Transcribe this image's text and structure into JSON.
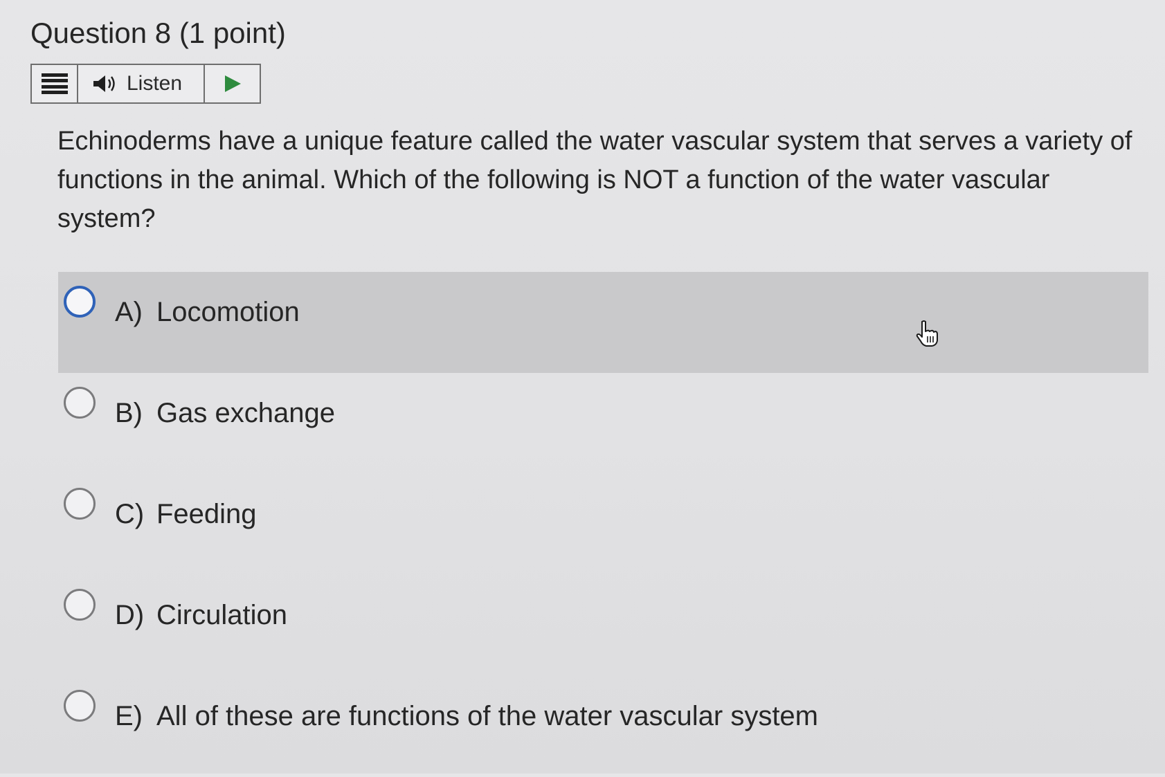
{
  "question": {
    "name": "Question 8",
    "points": "(1 point)"
  },
  "listen_toolbar": {
    "label": "Listen"
  },
  "stem": "Echinoderms have a unique feature called the water vascular system that serves a variety of functions in the animal.  Which of the following is NOT a function of the water vascular system?",
  "options": [
    {
      "letter": "A)",
      "text": "Locomotion",
      "hovered": true,
      "selected": false
    },
    {
      "letter": "B)",
      "text": "Gas exchange",
      "hovered": false,
      "selected": false
    },
    {
      "letter": "C)",
      "text": "Feeding",
      "hovered": false,
      "selected": false
    },
    {
      "letter": "D)",
      "text": "Circulation",
      "hovered": false,
      "selected": false
    },
    {
      "letter": "E)",
      "text": "All of these are functions of the water vascular system",
      "hovered": false,
      "selected": false
    }
  ],
  "colors": {
    "hover_row": "#c9c9cb",
    "radio_focus": "#2f62b8",
    "play_icon": "#2e8b3e"
  },
  "icons": {
    "menu": "menu-icon",
    "speaker": "speaker-icon",
    "play": "play-icon",
    "cursor": "hand-pointer-icon"
  }
}
